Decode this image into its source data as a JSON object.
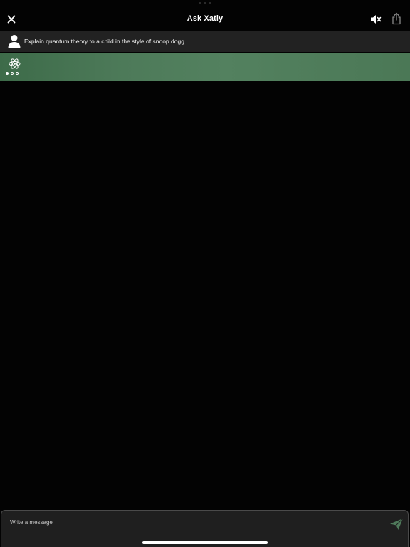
{
  "header": {
    "title": "Ask Xatly",
    "close_icon": "close-icon",
    "mute_icon": "speaker-muted-icon",
    "share_icon": "share-icon"
  },
  "conversation": {
    "user_message": {
      "avatar_icon": "user-avatar-icon",
      "text": "Explain quantum theory to a child in the style of snoop dogg"
    },
    "assistant_response": {
      "icon": "atom-icon",
      "state": "typing",
      "typing_dots": 3,
      "typing_active_dot": 1
    }
  },
  "composer": {
    "placeholder": "Write a message",
    "value": "",
    "send_icon": "send-icon"
  },
  "colors": {
    "background": "#030303",
    "user_row": "#222222",
    "assistant_row": "#4d7a59",
    "send_icon": "#4f7a5b"
  }
}
